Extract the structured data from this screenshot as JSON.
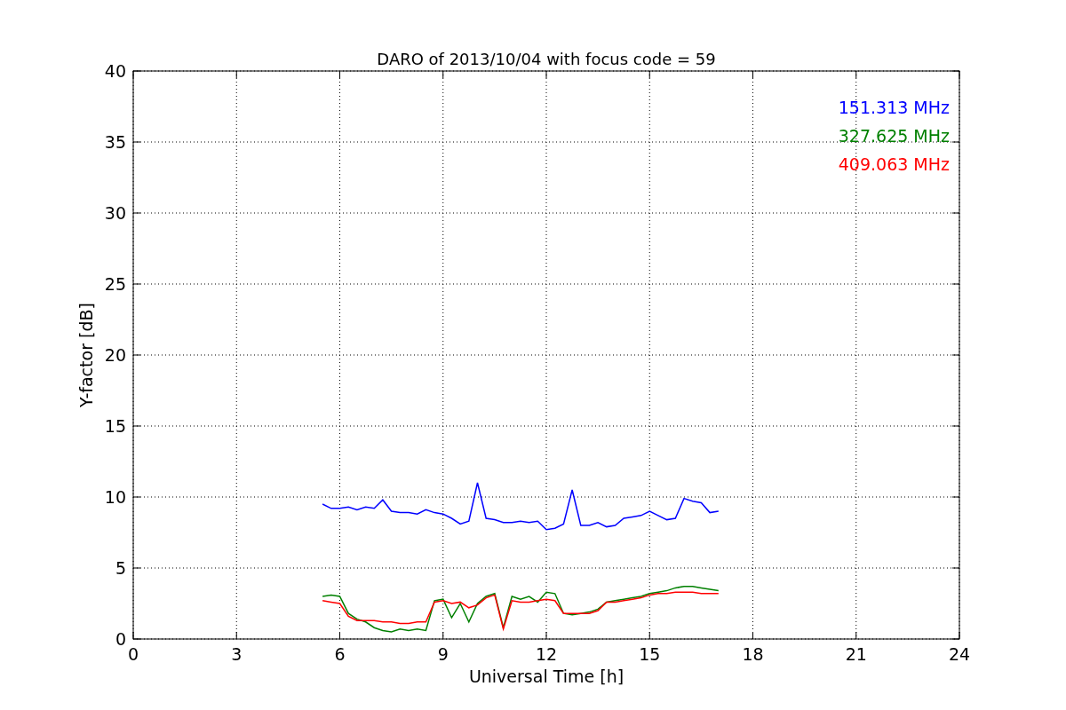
{
  "chart_data": {
    "type": "line",
    "grid": true,
    "title": "DARO of 2013/10/04 with focus code = 59",
    "xlabel": "Universal Time [h]",
    "ylabel": "Y-factor [dB]",
    "xlim": [
      0,
      24
    ],
    "ylim": [
      0,
      40
    ],
    "xticks": [
      0,
      3,
      6,
      9,
      12,
      15,
      18,
      21,
      24
    ],
    "yticks": [
      0,
      5,
      10,
      15,
      20,
      25,
      30,
      35,
      40
    ],
    "x": [
      5.5,
      5.75,
      6,
      6.25,
      6.5,
      6.75,
      7,
      7.25,
      7.5,
      7.75,
      8,
      8.25,
      8.5,
      8.75,
      9,
      9.25,
      9.5,
      9.75,
      10,
      10.25,
      10.5,
      10.75,
      11,
      11.25,
      11.5,
      11.75,
      12,
      12.25,
      12.5,
      12.75,
      13,
      13.25,
      13.5,
      13.75,
      14,
      14.25,
      14.5,
      14.75,
      15,
      15.25,
      15.5,
      15.75,
      16,
      16.25,
      16.5,
      16.75,
      17
    ],
    "series": [
      {
        "name": "151.313 MHz",
        "color": "#0000ff",
        "values": [
          9.5,
          9.2,
          9.2,
          9.3,
          9.1,
          9.3,
          9.2,
          9.8,
          9.0,
          8.9,
          8.9,
          8.8,
          9.1,
          8.9,
          8.8,
          8.5,
          8.1,
          8.3,
          11.0,
          8.5,
          8.4,
          8.2,
          8.2,
          8.3,
          8.2,
          8.3,
          7.7,
          7.8,
          8.1,
          10.5,
          8.0,
          8.0,
          8.2,
          7.9,
          8.0,
          8.5,
          8.6,
          8.7,
          9.0,
          8.7,
          8.4,
          8.5,
          9.9,
          9.7,
          9.6,
          8.9,
          9.0
        ]
      },
      {
        "name": "327.625 MHz",
        "color": "#008000",
        "values": [
          3.0,
          3.1,
          3.0,
          1.8,
          1.4,
          1.2,
          0.8,
          0.6,
          0.5,
          0.7,
          0.6,
          0.7,
          0.6,
          2.7,
          2.8,
          1.5,
          2.5,
          1.2,
          2.5,
          3.0,
          3.2,
          0.8,
          3.0,
          2.8,
          3.0,
          2.6,
          3.3,
          3.2,
          1.8,
          1.7,
          1.8,
          1.9,
          2.1,
          2.6,
          2.7,
          2.8,
          2.9,
          3.0,
          3.2,
          3.3,
          3.4,
          3.6,
          3.7,
          3.7,
          3.6,
          3.5,
          3.4
        ]
      },
      {
        "name": "409.063 MHz",
        "color": "#ff0000",
        "values": [
          2.7,
          2.6,
          2.5,
          1.6,
          1.3,
          1.3,
          1.3,
          1.2,
          1.2,
          1.1,
          1.1,
          1.2,
          1.2,
          2.6,
          2.7,
          2.5,
          2.6,
          2.2,
          2.4,
          2.9,
          3.1,
          0.7,
          2.7,
          2.6,
          2.6,
          2.7,
          2.8,
          2.7,
          1.8,
          1.8,
          1.8,
          1.8,
          2.0,
          2.6,
          2.6,
          2.7,
          2.8,
          2.9,
          3.1,
          3.2,
          3.2,
          3.3,
          3.3,
          3.3,
          3.2,
          3.2,
          3.2
        ]
      }
    ]
  }
}
